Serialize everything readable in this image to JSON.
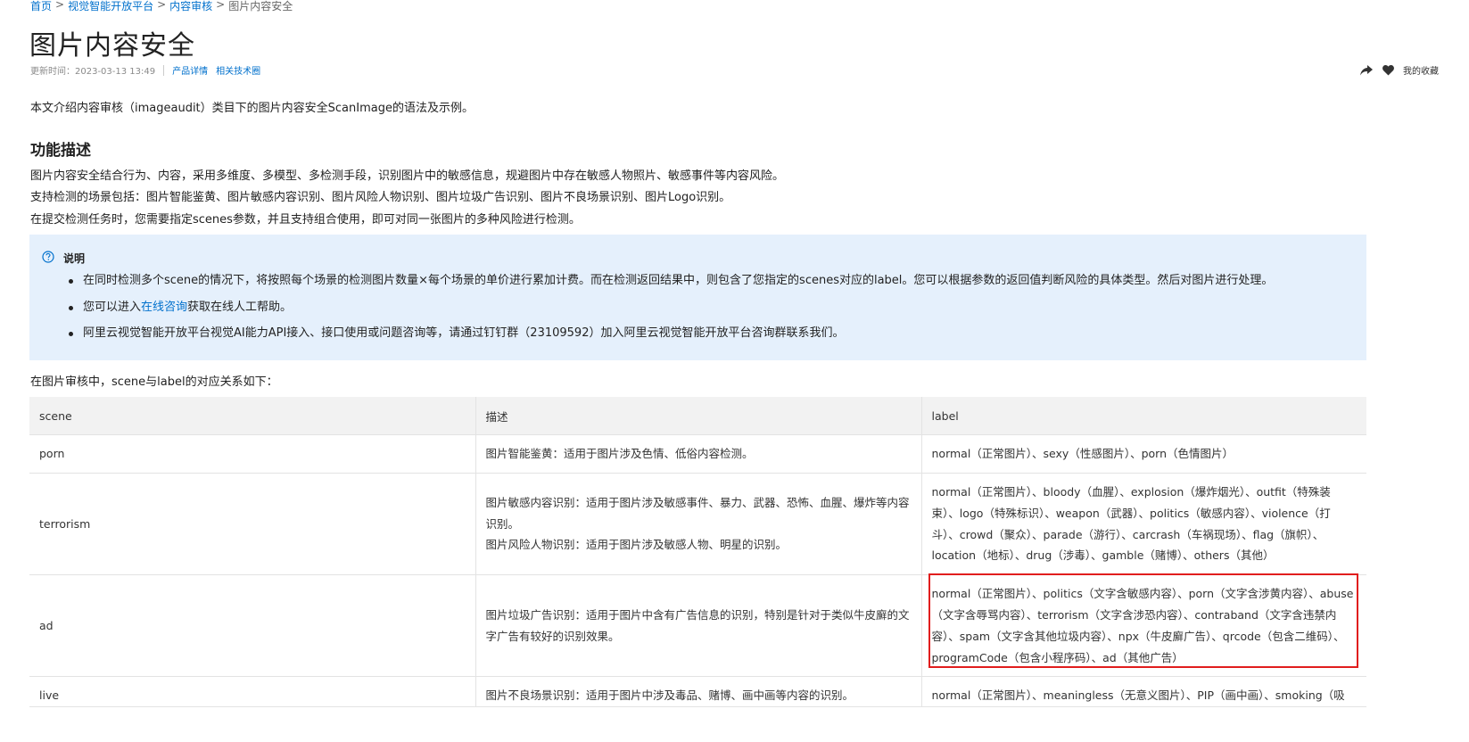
{
  "breadcrumb": {
    "items": [
      "首页",
      "视觉智能开放平台",
      "内容审核"
    ],
    "current": "图片内容安全",
    "separator": ">"
  },
  "page_title": "图片内容安全",
  "meta": {
    "updated": "更新时间：2023-03-13 13:49",
    "links": [
      "产品详情",
      "相关技术圈"
    ]
  },
  "actions": {
    "share_icon": "share-icon",
    "favorite_icon": "heart-icon",
    "favorites_label": "我的收藏"
  },
  "intro": "本文介绍内容审核（imageaudit）类目下的图片内容安全ScanImage的语法及示例。",
  "section": {
    "heading": "功能描述",
    "paragraphs": [
      "图片内容安全结合行为、内容，采用多维度、多模型、多检测手段，识别图片中的敏感信息，规避图片中存在敏感人物照片、敏感事件等内容风险。",
      "支持检测的场景包括：图片智能鉴黄、图片敏感内容识别、图片风险人物识别、图片垃圾广告识别、图片不良场景识别、图片Logo识别。",
      "在提交检测任务时，您需要指定scenes参数，并且支持组合使用，即可对同一张图片的多种风险进行检测。"
    ]
  },
  "note": {
    "icon": "help-circle-icon",
    "title": "说明",
    "items": [
      {
        "text": "在同时检测多个scene的情况下，将按照每个场景的检测图片数量×每个场景的单价进行累加计费。而在检测返回结果中，则包含了您指定的scenes对应的label。您可以根据参数的返回值判断风险的具体类型。然后对图片进行处理。"
      },
      {
        "before": "您可以进入",
        "link": "在线咨询",
        "after": "获取在线人工帮助。"
      },
      {
        "text": "阿里云视觉智能开放平台视觉AI能力API接入、接口使用或问题咨询等，请通过钉钉群（23109592）加入阿里云视觉智能开放平台咨询群联系我们。"
      }
    ]
  },
  "mapping_intro": "在图片审核中，scene与label的对应关系如下：",
  "table": {
    "headers": [
      "scene",
      "描述",
      "label"
    ],
    "rows": [
      {
        "scene": "porn",
        "desc": [
          "图片智能鉴黄：适用于图片涉及色情、低俗内容检测。"
        ],
        "label": "normal（正常图片）、sexy（性感图片）、porn（色情图片）"
      },
      {
        "scene": "terrorism",
        "desc": [
          "图片敏感内容识别：适用于图片涉及敏感事件、暴力、武器、恐怖、血腥、爆炸等内容识别。",
          "图片风险人物识别：适用于图片涉及敏感人物、明星的识别。"
        ],
        "label": "normal（正常图片）、bloody（血腥）、explosion（爆炸烟光）、outfit（特殊装束）、logo（特殊标识）、weapon（武器）、politics（敏感内容）、violence（打斗）、crowd（聚众）、parade（游行）、carcrash（车祸现场）、flag（旗帜）、location（地标）、drug（涉毒）、gamble（赌博）、others（其他）"
      },
      {
        "scene": "ad",
        "desc": [
          "图片垃圾广告识别：适用于图片中含有广告信息的识别，特别是针对于类似牛皮廯的文字广告有较好的识别效果。"
        ],
        "label": "normal（正常图片）、politics（文字含敏感内容）、porn（文字含涉黄内容）、abuse（文字含辱骂内容）、terrorism（文字含涉恐内容）、contraband（文字含违禁内容）、spam（文字含其他垃圾内容）、npx（牛皮廯广告）、qrcode（包含二维码）、programCode（包含小程序码）、ad（其他广告）"
      },
      {
        "scene": "live",
        "desc": [
          "图片不良场景识别：适用于图片中涉及毒品、赌博、画中画等内容的识别。"
        ],
        "label": "normal（正常图片）、meaningless（无意义图片）、PIP（画中画）、smoking（吸"
      }
    ]
  },
  "colors": {
    "link": "#0070cc",
    "note_bg": "#e5f0fc",
    "table_header_bg": "#f2f2f2",
    "highlight": "#e11d1d"
  }
}
